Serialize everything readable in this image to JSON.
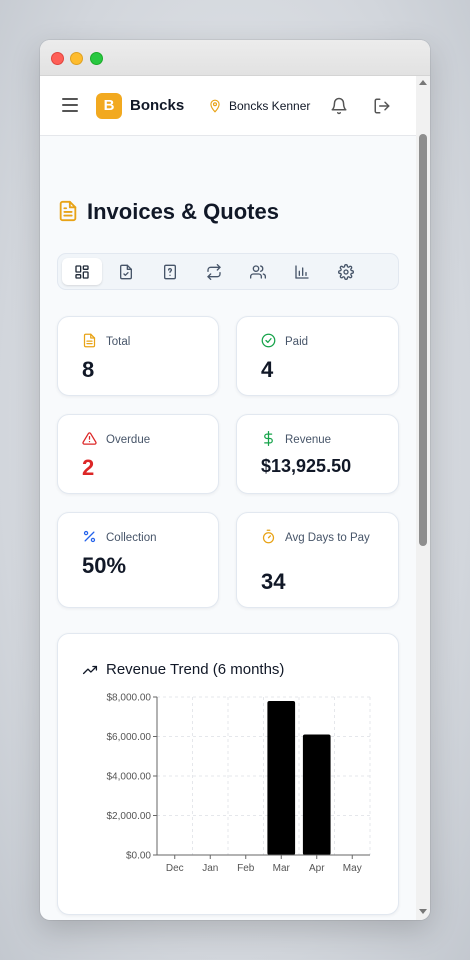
{
  "app": {
    "brand": "Boncks",
    "logo_letter": "B",
    "location": "Boncks Kenner"
  },
  "page": {
    "title": "Invoices & Quotes"
  },
  "toolbar": {
    "tools": [
      {
        "icon": "dashboard-icon",
        "active": true
      },
      {
        "icon": "file-check-icon",
        "active": false
      },
      {
        "icon": "file-question-icon",
        "active": false
      },
      {
        "icon": "recurring-icon",
        "active": false
      },
      {
        "icon": "users-icon",
        "active": false
      },
      {
        "icon": "bar-chart-icon",
        "active": false
      },
      {
        "icon": "settings-icon",
        "active": false
      }
    ]
  },
  "stats": {
    "total": {
      "label": "Total",
      "value": "8",
      "icon": "document-icon",
      "color": "#e8a317"
    },
    "paid": {
      "label": "Paid",
      "value": "4",
      "icon": "check-circle-icon",
      "color": "#16a34a"
    },
    "overdue": {
      "label": "Overdue",
      "value": "2",
      "icon": "warning-icon",
      "color": "#dc2626"
    },
    "revenue": {
      "label": "Revenue",
      "value": "$13,925.50",
      "icon": "dollar-icon",
      "color": "#16a34a"
    },
    "collection": {
      "label": "Collection",
      "value": "50%",
      "icon": "percent-icon",
      "color": "#2563eb"
    },
    "avg_days": {
      "label": "Avg Days to Pay",
      "value": "34",
      "icon": "stopwatch-icon",
      "color": "#e8a317"
    }
  },
  "chart_data": {
    "type": "bar",
    "title": "Revenue Trend (6 months)",
    "categories": [
      "Dec",
      "Jan",
      "Feb",
      "Mar",
      "Apr",
      "May"
    ],
    "values": [
      0,
      0,
      0,
      7800,
      6100,
      0
    ],
    "ylim": [
      0,
      8000
    ],
    "yticks": [
      0,
      2000,
      4000,
      6000,
      8000
    ],
    "ytick_labels": [
      "$0.00",
      "$2,000.00",
      "$4,000.00",
      "$6,000.00",
      "$8,000.00"
    ],
    "grid": true,
    "bar_color": "#000000",
    "xlabel": "",
    "ylabel": ""
  }
}
